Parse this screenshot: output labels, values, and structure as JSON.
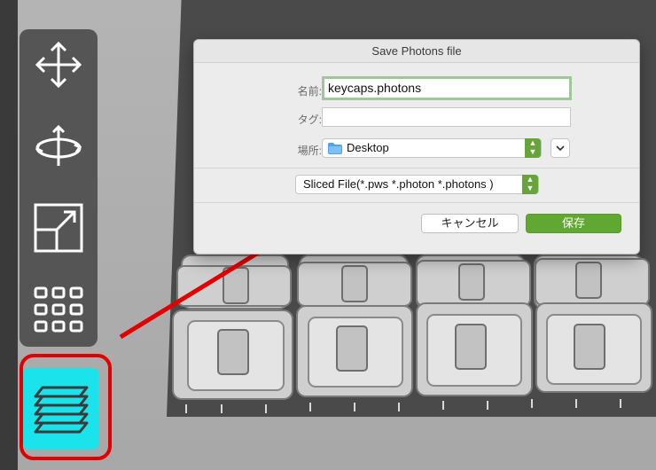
{
  "dialog": {
    "title": "Save Photons file",
    "name_label": "名前:",
    "name_value": "keycaps.photons",
    "tags_label": "タグ:",
    "tags_value": "",
    "location_label": "場所:",
    "location_value": "Desktop",
    "format_value": "Sliced File(*.pws *.photon *.photons )",
    "cancel_label": "キャンセル",
    "save_label": "保存"
  },
  "toolbar": {
    "tools": [
      {
        "name": "move-icon"
      },
      {
        "name": "rotate-icon"
      },
      {
        "name": "scale-icon"
      },
      {
        "name": "arrange-grid-icon"
      }
    ],
    "layers_button": {
      "name": "layers-icon",
      "highlighted": true
    }
  },
  "colors": {
    "accent_cyan": "#1be3eb",
    "highlight_red": "#e00000",
    "save_green": "#61a832",
    "toolbar_gray": "#555555"
  }
}
